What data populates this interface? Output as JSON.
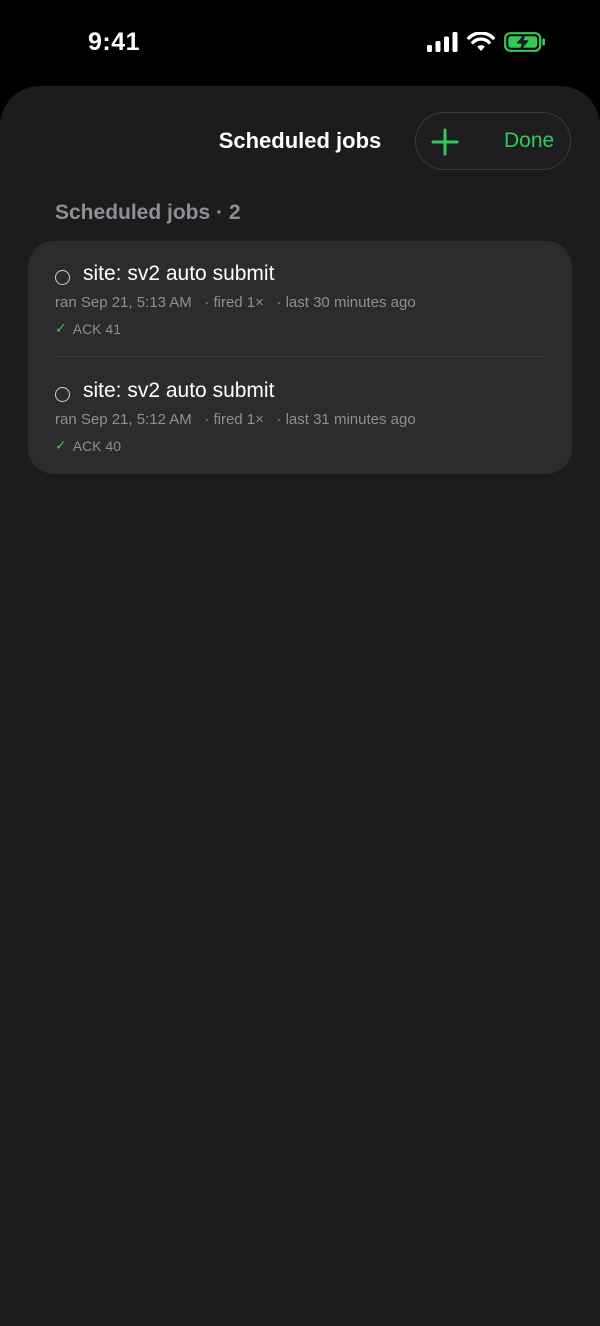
{
  "status_bar": {
    "time": "9:41",
    "signal_icon": "cellular-signal-icon",
    "wifi_icon": "wifi-icon",
    "battery_icon": "battery-charging-icon",
    "battery_color": "#34c759"
  },
  "nav": {
    "title": "Scheduled jobs",
    "add_icon": "plus-icon",
    "done_label": "Done",
    "accent_color": "#34c759"
  },
  "section": {
    "header": "Scheduled jobs · 2"
  },
  "jobs": [
    {
      "title": "site: sv2 auto submit",
      "ran": "ran Sep 21, 5:13 AM",
      "fired": "· fired 1×",
      "last": "· last 30 minutes ago",
      "ack": "ACK 41"
    },
    {
      "title": "site: sv2 auto submit",
      "ran": "ran Sep 21, 5:12 AM",
      "fired": "· fired 1×",
      "last": "· last 31 minutes ago",
      "ack": "ACK 40"
    }
  ]
}
